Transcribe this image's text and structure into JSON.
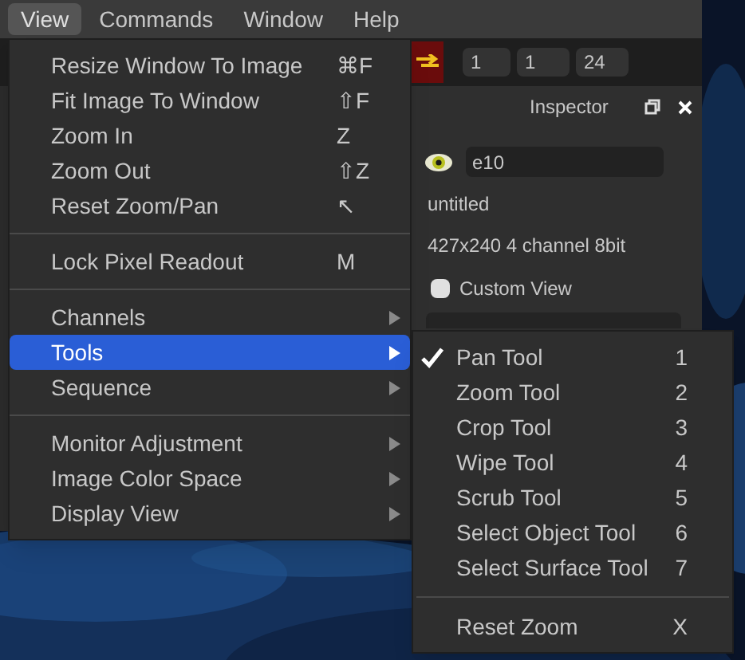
{
  "menubar": [
    {
      "label": "View",
      "selected": true
    },
    {
      "label": "Commands",
      "selected": false
    },
    {
      "label": "Window",
      "selected": false
    },
    {
      "label": "Help",
      "selected": false
    }
  ],
  "toolbar": {
    "fields": [
      "1",
      "1",
      "24"
    ]
  },
  "inspector": {
    "title": "Inspector",
    "layer_name": "e10",
    "name": "untitled",
    "info": "427x240 4 channel 8bit",
    "custom_view": {
      "label": "Custom View",
      "checked": false
    }
  },
  "view_menu": [
    {
      "kind": "item",
      "label": "Resize Window To Image",
      "shortcut": "⌘F",
      "selected": false
    },
    {
      "kind": "item",
      "label": "Fit Image To Window",
      "shortcut": "⇧F",
      "selected": false
    },
    {
      "kind": "item",
      "label": "Zoom In",
      "shortcut": "Z",
      "selected": false
    },
    {
      "kind": "item",
      "label": "Zoom Out",
      "shortcut": "⇧Z",
      "selected": false
    },
    {
      "kind": "item",
      "label": "Reset Zoom/Pan",
      "shortcut": "↖",
      "selected": false
    },
    {
      "kind": "separator"
    },
    {
      "kind": "item",
      "label": "Lock Pixel Readout",
      "shortcut": "M",
      "selected": false
    },
    {
      "kind": "separator"
    },
    {
      "kind": "submenu",
      "label": "Channels",
      "selected": false
    },
    {
      "kind": "submenu",
      "label": "Tools",
      "selected": true
    },
    {
      "kind": "submenu",
      "label": "Sequence",
      "selected": false
    },
    {
      "kind": "separator"
    },
    {
      "kind": "submenu",
      "label": "Monitor Adjustment",
      "selected": false
    },
    {
      "kind": "submenu",
      "label": "Image Color Space",
      "selected": false
    },
    {
      "kind": "submenu",
      "label": "Display View",
      "selected": false
    }
  ],
  "tools_menu": [
    {
      "kind": "item",
      "label": "Pan Tool",
      "shortcut": "1",
      "checked": true
    },
    {
      "kind": "item",
      "label": "Zoom Tool",
      "shortcut": "2",
      "checked": false
    },
    {
      "kind": "item",
      "label": "Crop Tool",
      "shortcut": "3",
      "checked": false
    },
    {
      "kind": "item",
      "label": "Wipe Tool",
      "shortcut": "4",
      "checked": false
    },
    {
      "kind": "item",
      "label": "Scrub Tool",
      "shortcut": "5",
      "checked": false
    },
    {
      "kind": "item",
      "label": "Select Object Tool",
      "shortcut": "6",
      "checked": false
    },
    {
      "kind": "item",
      "label": "Select Surface Tool",
      "shortcut": "7",
      "checked": false
    },
    {
      "kind": "separator"
    },
    {
      "kind": "item",
      "label": "Reset Zoom",
      "shortcut": "X",
      "checked": false
    }
  ]
}
